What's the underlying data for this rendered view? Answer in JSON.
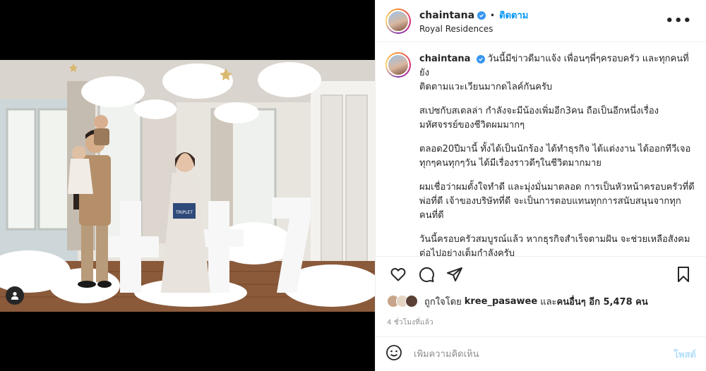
{
  "header": {
    "username": "chaintana",
    "separator": "•",
    "follow_label": "ติดตาม",
    "location": "Royal Residences",
    "more_label": "•••"
  },
  "caption": {
    "username": "chaintana",
    "paragraphs": [
      [
        "วันนี้มีข่าวดีมาแจ้ง เพื่อนๆพี่ๆครอบครัว และทุกคนที่ยัง",
        "ติดตามแวะเวียนมากดไลค์กันครับ"
      ],
      [
        "สเปซกับสเตลล่า กำลังจะมีน้องเพิ่มอีก3คน ถือเป็นอีกหนึ่งเรื่อง",
        "มหัศจรรย์ของชีวิตผมมากๆ"
      ],
      [
        "ตลอด20ปีมานี้ ทั้งได้เป็นนักร้อง ได้ทำธุรกิจ ได้แต่งงาน ได้ออกทีวีเจอ",
        "ทุกๆคนทุกๆวัน ได้มีเรื่องราวดีๆในชีวิตมากมาย"
      ],
      [
        "ผมเชื่อว่าผมตั้งใจทำดี และมุ่งมั่นมาตลอด การเป็นหัวหน้าครอบครัวที่ดี",
        "พ่อที่ดี เจ้าของบริษัทที่ดี จะเป็นการตอบแทนทุกการสนับสนุนจากทุก",
        "คนที่ดี"
      ],
      [
        "วันนี้ครอบครัวสมบูรณ์แล้ว หากธุรกิจสำเร็จตามฝัน จะช่วยเหลือสังคม",
        "ต่อไปอย่างเต็มกำลังครับ"
      ]
    ]
  },
  "likes": {
    "prefix": "ถูกใจโดย",
    "user": "kree_pasawee",
    "and": "และ",
    "others": "คนอื่นๆ อีก 5,478 คน"
  },
  "timestamp": "4 ชั่วโมงที่แล้ว",
  "comment": {
    "placeholder": "เพิ่มความคิดเห็น",
    "post_label": "โพสต์"
  },
  "photo": {
    "sign_text": "TRIPLET",
    "numbers": [
      "+",
      "+",
      "7"
    ]
  },
  "colors": {
    "accent": "#0095f6",
    "post_disabled": "#b2dffc",
    "verified": "#3897f0",
    "muted": "#8e8e8e"
  },
  "icons": {
    "like": "heart-icon",
    "comment": "comment-icon",
    "share": "paper-plane-icon",
    "save": "bookmark-icon",
    "emoji": "smiley-icon",
    "tag": "user-tag-icon"
  }
}
